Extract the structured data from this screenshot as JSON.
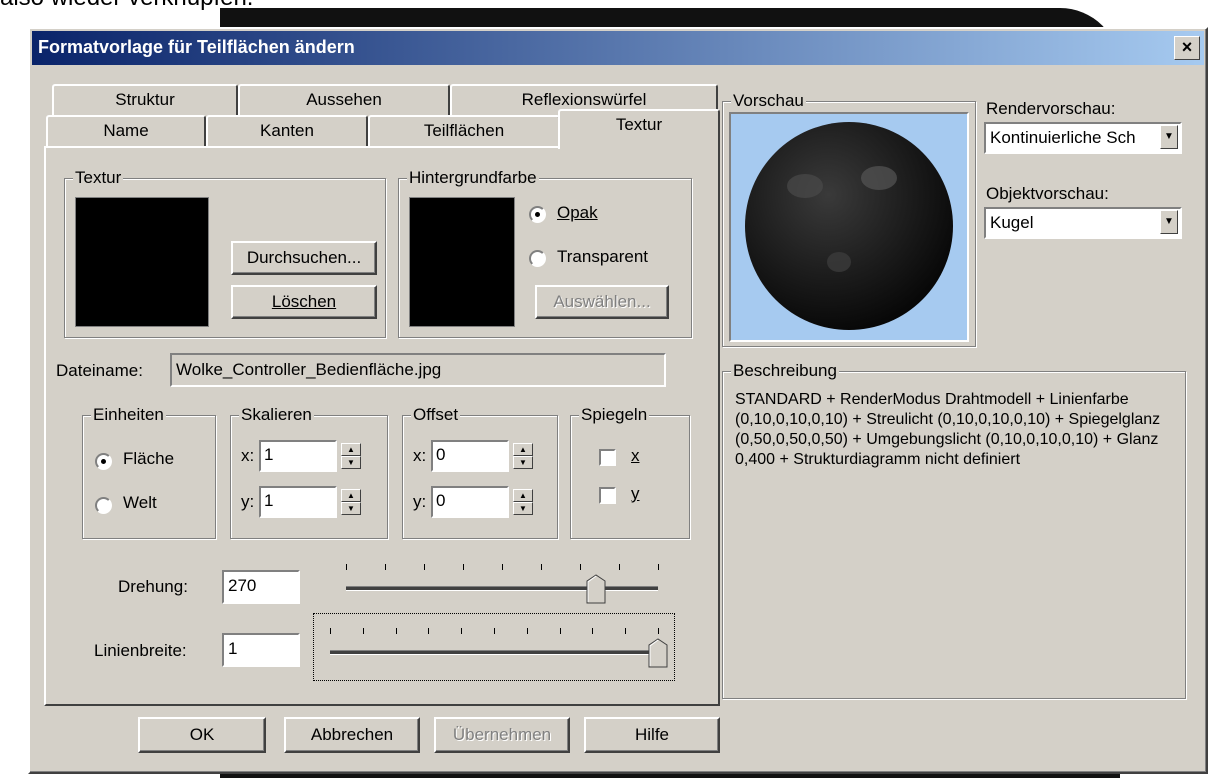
{
  "background_text": "also wieder verknüpfen.",
  "dialog": {
    "title": "Formatvorlage für Teilflächen ändern",
    "close": "×"
  },
  "tabs": {
    "row1": [
      "Struktur",
      "Aussehen",
      "Reflexionswürfel"
    ],
    "row2": [
      "Name",
      "Kanten",
      "Teilflächen",
      "Textur"
    ],
    "active": "Textur"
  },
  "textur_group": {
    "label": "Textur",
    "browse": "Durchsuchen...",
    "delete": "Löschen"
  },
  "hintergrund_group": {
    "label": "Hintergrundfarbe",
    "opak": "Opak",
    "transparent": "Transparent",
    "selected": "Opak",
    "choose": "Auswählen..."
  },
  "dateiname": {
    "label": "Dateiname:",
    "value": "Wolke_Controller_Bedienfläche.jpg"
  },
  "einheiten": {
    "label": "Einheiten",
    "flaeche": "Fläche",
    "welt": "Welt",
    "selected": "Fläche"
  },
  "skalieren": {
    "label": "Skalieren",
    "x_label": "x:",
    "y_label": "y:",
    "x": "1",
    "y": "1"
  },
  "offset": {
    "label": "Offset",
    "x_label": "x:",
    "y_label": "y:",
    "x": "0",
    "y": "0"
  },
  "spiegeln": {
    "label": "Spiegeln",
    "x": "x",
    "y": "y",
    "x_checked": false,
    "y_checked": false
  },
  "drehung": {
    "label": "Drehung:",
    "value": "270",
    "slider_position": 0.8
  },
  "linienbreite": {
    "label": "Linienbreite:",
    "value": "1",
    "slider_position": 1.0
  },
  "buttons": {
    "ok": "OK",
    "cancel": "Abbrechen",
    "apply": "Übernehmen",
    "help": "Hilfe"
  },
  "vorschau": {
    "label": "Vorschau",
    "sphere_bg": "#a6caf0"
  },
  "rendervorschau": {
    "label": "Rendervorschau:",
    "value": "Kontinuierliche Sch"
  },
  "objektvorschau": {
    "label": "Objektvorschau:",
    "value": "Kugel"
  },
  "beschreibung": {
    "label": "Beschreibung",
    "text": "STANDARD + RenderModus Drahtmodell + Linienfarbe (0,10,0,10,0,10) + Streulicht (0,10,0,10,0,10) + Spiegelglanz (0,50,0,50,0,50) + Umgebungslicht (0,10,0,10,0,10) + Glanz 0,400 + Strukturdiagramm nicht definiert"
  }
}
